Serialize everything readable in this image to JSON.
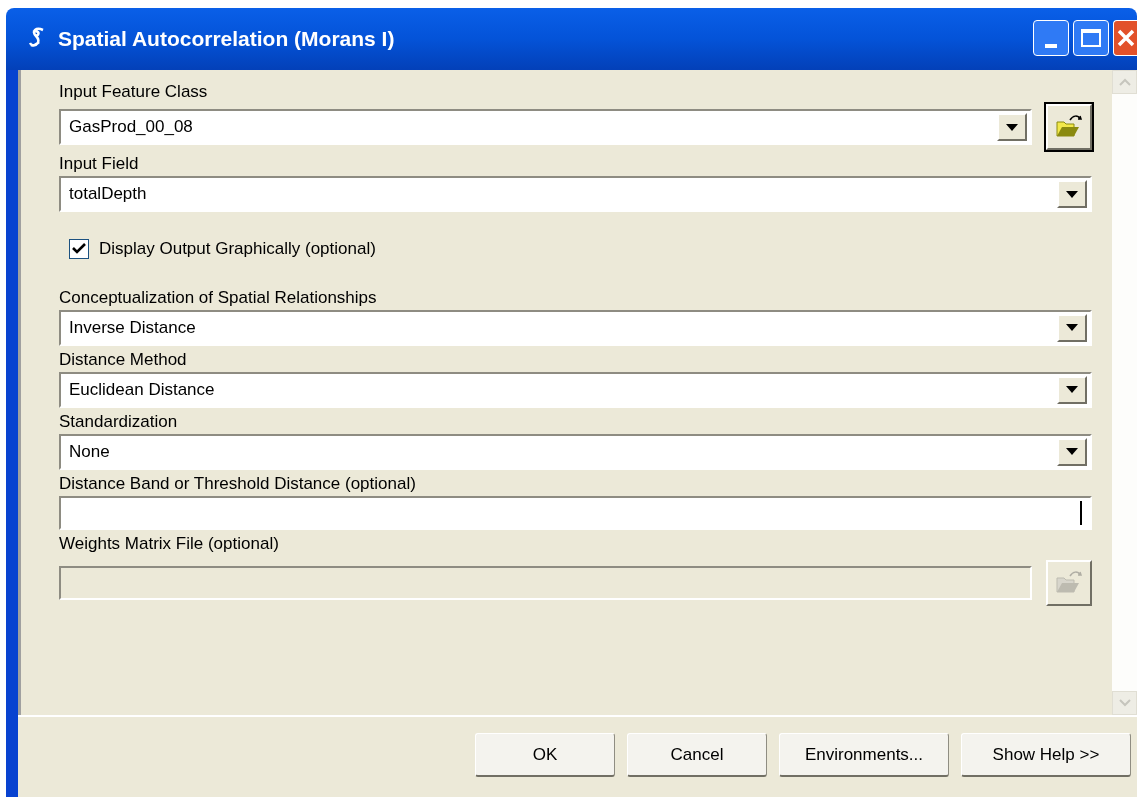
{
  "window": {
    "title": "Spatial Autocorrelation (Morans I)"
  },
  "params": [
    {
      "kind": "combo",
      "label": "Input Feature Class",
      "value": "GasProd_00_08",
      "browse": true,
      "disabled": false
    },
    {
      "kind": "combo",
      "label": "Input Field",
      "value": "totalDepth",
      "browse": false,
      "disabled": false
    },
    {
      "kind": "checkbox",
      "label": "Display Output Graphically (optional)",
      "checked": true
    },
    {
      "kind": "combo",
      "label": "Conceptualization of Spatial Relationships",
      "value": "Inverse Distance",
      "browse": false,
      "disabled": false
    },
    {
      "kind": "combo",
      "label": "Distance Method",
      "value": "Euclidean Distance",
      "browse": false,
      "disabled": false
    },
    {
      "kind": "combo",
      "label": "Standardization",
      "value": "None",
      "browse": false,
      "disabled": false
    },
    {
      "kind": "text",
      "label": "Distance Band or Threshold Distance (optional)",
      "browse": false,
      "disabled": false
    },
    {
      "kind": "text",
      "label": "Weights Matrix File (optional)",
      "browse": true,
      "disabled": true
    }
  ],
  "buttons": [
    "OK",
    "Cancel",
    "Environments...",
    "Show Help >>"
  ]
}
